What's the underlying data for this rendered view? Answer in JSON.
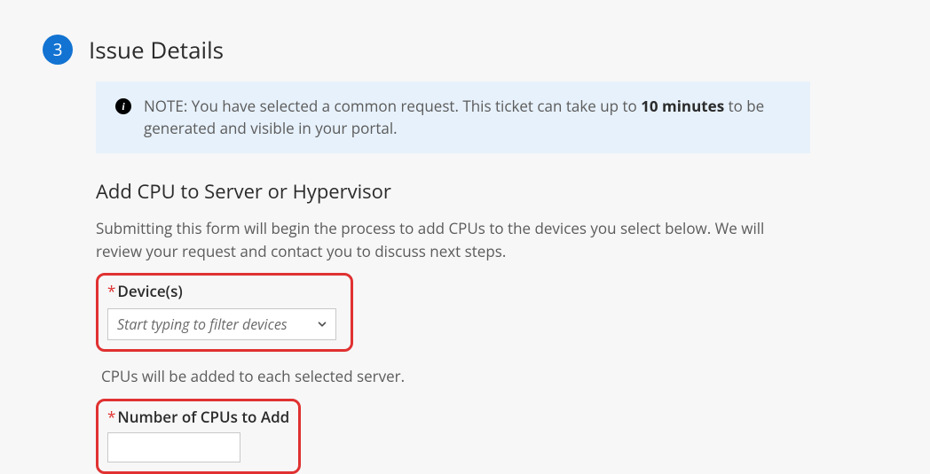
{
  "step": {
    "number": "3",
    "title": "Issue Details"
  },
  "note": {
    "label": "NOTE:",
    "pre": " You have selected a common request. This ticket can take up to ",
    "bold": "10 minutes",
    "post": " to be generated and visible in your portal."
  },
  "section": {
    "heading": "Add CPU to Server or Hypervisor",
    "description": "Submitting this form will begin the process to add CPUs to the devices you select below. We will review your request and contact you to discuss next steps."
  },
  "fields": {
    "devices": {
      "label": "Device(s)",
      "required_mark": "*",
      "placeholder": "Start typing to filter devices",
      "helper": "CPUs will be added to each selected server."
    },
    "cpu_count": {
      "label": "Number of CPUs to Add",
      "required_mark": "*",
      "value": ""
    }
  }
}
